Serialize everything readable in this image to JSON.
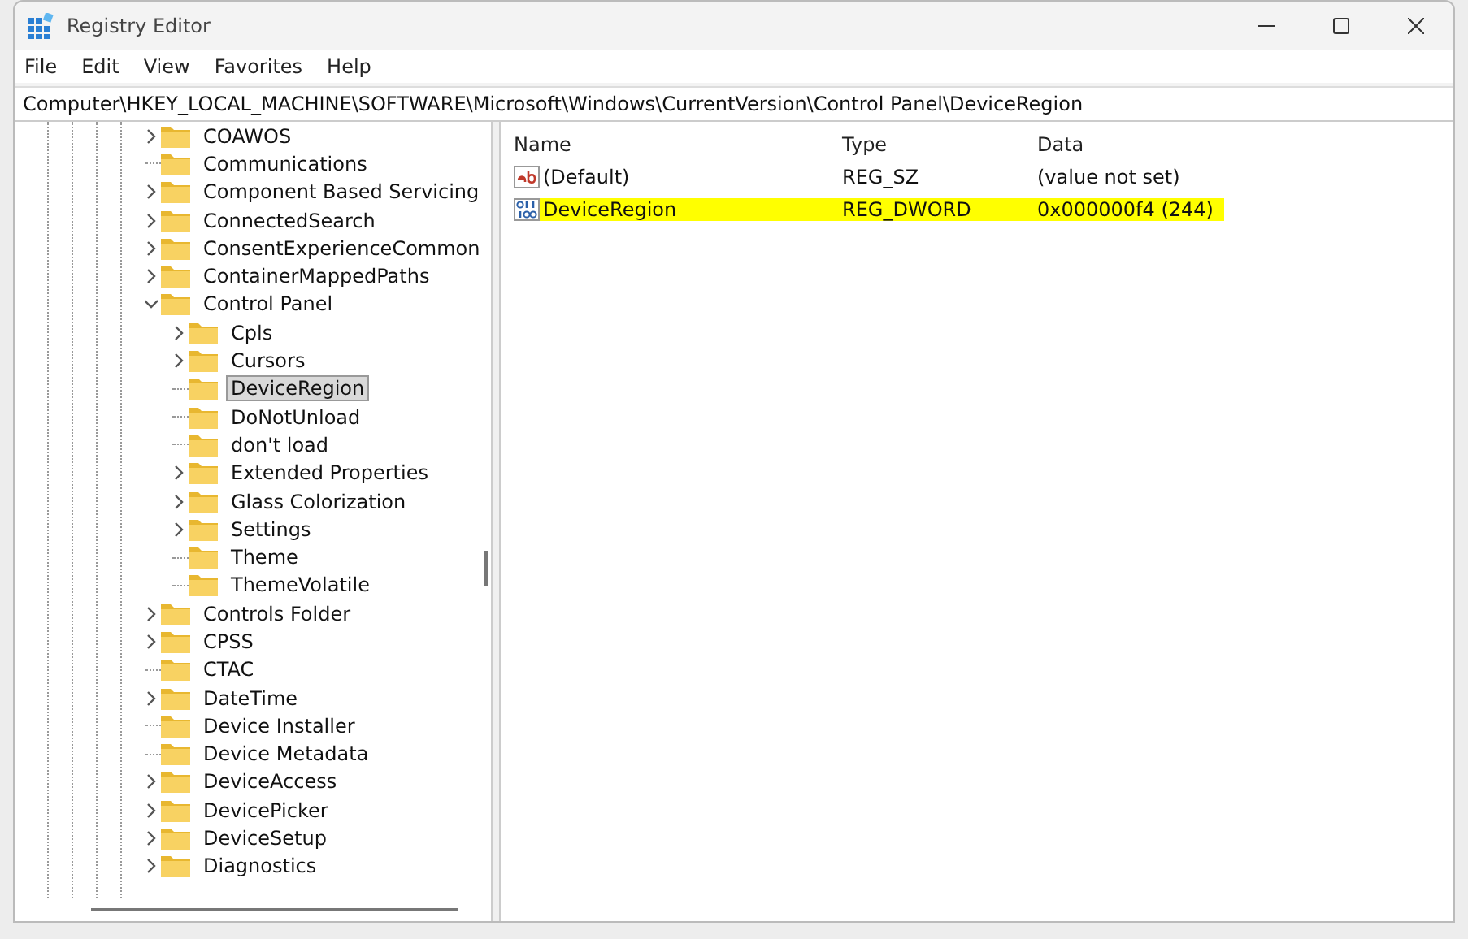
{
  "window": {
    "title": "Registry Editor"
  },
  "menu": [
    "File",
    "Edit",
    "View",
    "Favorites",
    "Help"
  ],
  "address": "Computer\\HKEY_LOCAL_MACHINE\\SOFTWARE\\Microsoft\\Windows\\CurrentVersion\\Control Panel\\DeviceRegion",
  "tree": [
    {
      "label": "COAWOS",
      "kind": "collapsed",
      "selected": false
    },
    {
      "label": "Communications",
      "kind": "leaf",
      "selected": false
    },
    {
      "label": "Component Based Servicing",
      "kind": "collapsed",
      "selected": false
    },
    {
      "label": "ConnectedSearch",
      "kind": "collapsed",
      "selected": false
    },
    {
      "label": "ConsentExperienceCommon",
      "kind": "collapsed",
      "selected": false
    },
    {
      "label": "ContainerMappedPaths",
      "kind": "collapsed",
      "selected": false
    },
    {
      "label": "Control Panel",
      "kind": "expanded",
      "selected": false,
      "children": [
        {
          "label": "Cpls",
          "kind": "collapsed",
          "selected": false
        },
        {
          "label": "Cursors",
          "kind": "collapsed",
          "selected": false
        },
        {
          "label": "DeviceRegion",
          "kind": "leaf",
          "selected": true
        },
        {
          "label": "DoNotUnload",
          "kind": "leaf",
          "selected": false
        },
        {
          "label": "don't load",
          "kind": "leaf",
          "selected": false
        },
        {
          "label": "Extended Properties",
          "kind": "collapsed",
          "selected": false
        },
        {
          "label": "Glass Colorization",
          "kind": "collapsed",
          "selected": false
        },
        {
          "label": "Settings",
          "kind": "collapsed",
          "selected": false
        },
        {
          "label": "Theme",
          "kind": "leaf",
          "selected": false
        },
        {
          "label": "ThemeVolatile",
          "kind": "leaf",
          "selected": false
        }
      ]
    },
    {
      "label": "Controls Folder",
      "kind": "collapsed",
      "selected": false
    },
    {
      "label": "CPSS",
      "kind": "collapsed",
      "selected": false
    },
    {
      "label": "CTAC",
      "kind": "leaf",
      "selected": false
    },
    {
      "label": "DateTime",
      "kind": "collapsed",
      "selected": false
    },
    {
      "label": "Device Installer",
      "kind": "leaf",
      "selected": false
    },
    {
      "label": "Device Metadata",
      "kind": "leaf",
      "selected": false
    },
    {
      "label": "DeviceAccess",
      "kind": "collapsed",
      "selected": false
    },
    {
      "label": "DevicePicker",
      "kind": "collapsed",
      "selected": false
    },
    {
      "label": "DeviceSetup",
      "kind": "collapsed",
      "selected": false
    },
    {
      "label": "Diagnostics",
      "kind": "collapsed",
      "selected": false
    }
  ],
  "columns": [
    "Name",
    "Type",
    "Data"
  ],
  "values": [
    {
      "kind": "string",
      "name": "(Default)",
      "type": "REG_SZ",
      "data": "(value not set)",
      "highlighted": false
    },
    {
      "kind": "binary",
      "name": "DeviceRegion",
      "type": "REG_DWORD",
      "data": "0x000000f4 (244)",
      "highlighted": true
    }
  ]
}
